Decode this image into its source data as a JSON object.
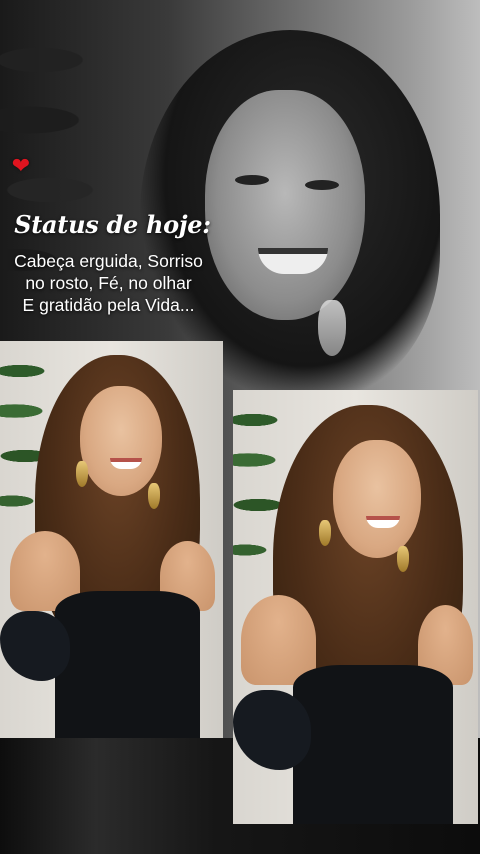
{
  "status": {
    "title": "Status de hoje:",
    "lines": [
      "Cabeça erguida, Sorriso",
      "no rosto, Fé, no olhar",
      "E gratidão pela Vida..."
    ]
  },
  "icons": {
    "heart": "heart-icon"
  },
  "colors": {
    "heart": "#e0141f",
    "text": "#ffffff",
    "dress": "#111316",
    "hair": "#4a2c17"
  }
}
